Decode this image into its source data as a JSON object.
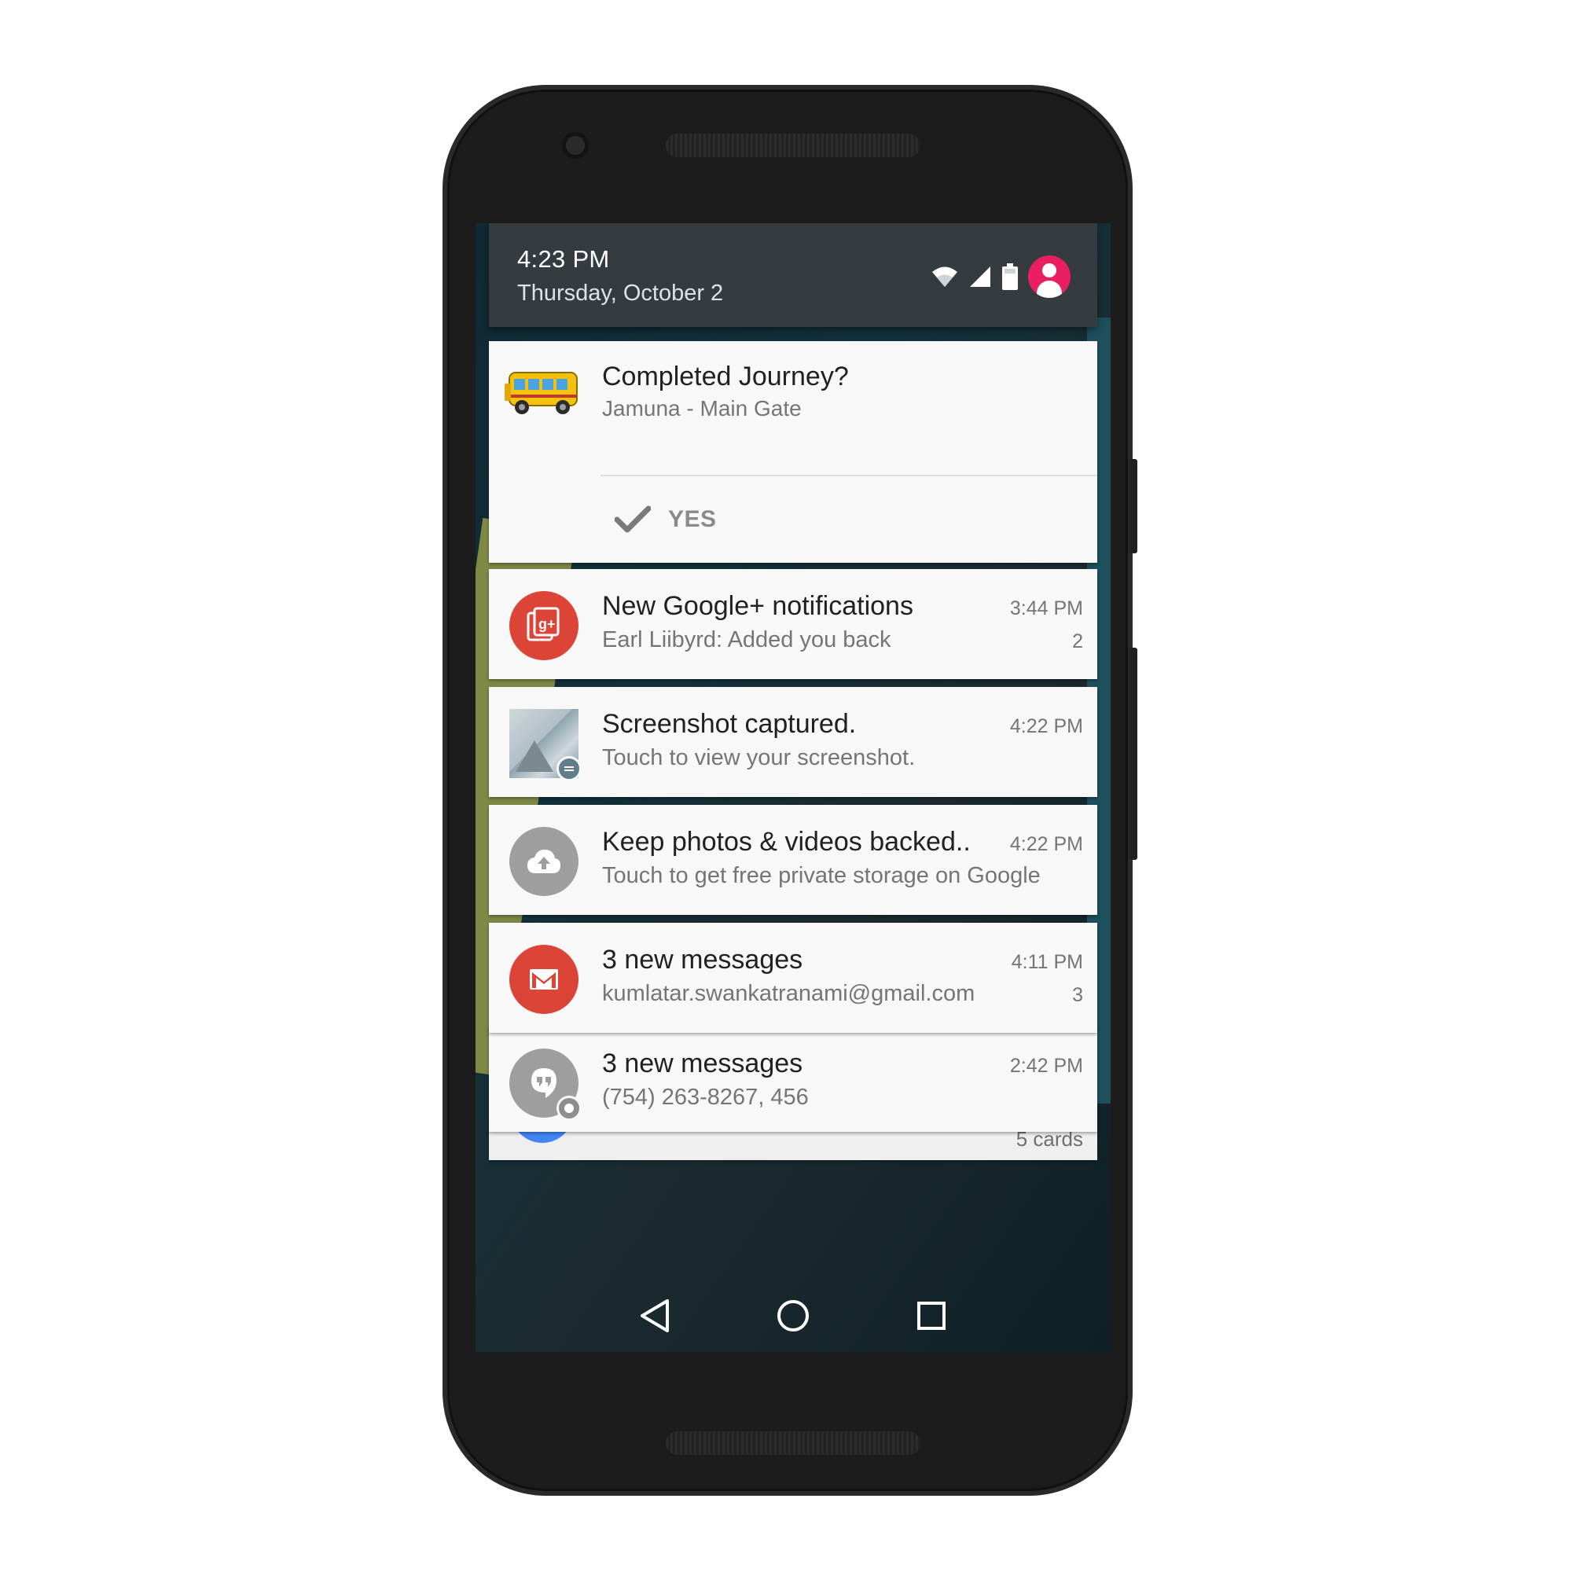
{
  "status_bar": {
    "time": "4:23 PM",
    "date": "Thursday, October 2",
    "icons": [
      "wifi-icon",
      "cell-signal-icon",
      "battery-icon",
      "user-avatar-icon"
    ],
    "avatar_color": "#e91e63"
  },
  "notifications": [
    {
      "id": "journey",
      "icon": "bus-icon",
      "title": "Completed Journey?",
      "subtitle": "Jamuna - Main Gate",
      "action": {
        "icon": "check-icon",
        "label": "YES"
      }
    },
    {
      "id": "gplus",
      "icon": "google-plus-icon",
      "icon_color": "#db4437",
      "title": "New Google+ notifications",
      "subtitle": "Earl Liibyrd: Added you back",
      "time": "3:44 PM",
      "count": "2"
    },
    {
      "id": "screenshot",
      "icon": "screenshot-thumbnail",
      "title": "Screenshot captured.",
      "subtitle": "Touch to view your screenshot.",
      "time": "4:22 PM"
    },
    {
      "id": "photos",
      "icon": "cloud-upload-icon",
      "icon_color": "#9e9e9e",
      "title": "Keep photos & videos backed..",
      "subtitle": "Touch to get free private storage on Google",
      "time": "4:22 PM"
    },
    {
      "id": "gmail",
      "icon": "gmail-icon",
      "icon_color": "#db4437",
      "title": "3 new messages",
      "subtitle": "kumlatar.swankatranami@gmail.com",
      "time": "4:11 PM",
      "count": "3"
    },
    {
      "id": "hangouts",
      "icon": "hangouts-icon",
      "icon_color": "#9e9e9e",
      "title": "3 new messages",
      "subtitle": "(754) 263-8267, 456",
      "time": "2:42 PM"
    }
  ],
  "peek_card": {
    "label": "5 cards"
  },
  "nav": {
    "back": "back-icon",
    "home": "home-icon",
    "recents": "recents-icon"
  }
}
